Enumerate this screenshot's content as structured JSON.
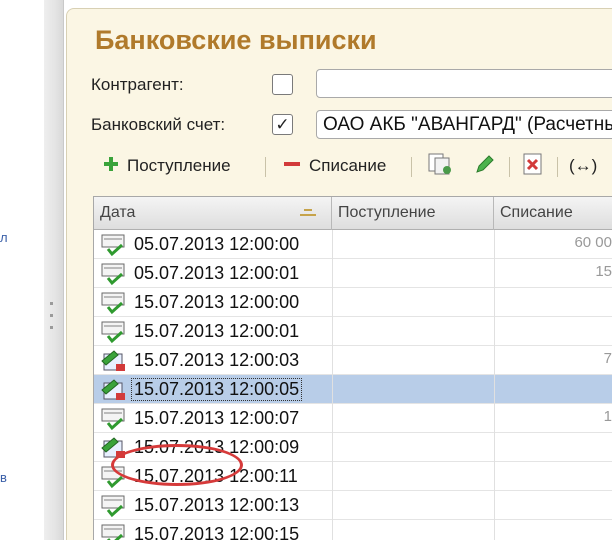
{
  "window": {
    "title": "Банковские выписки"
  },
  "left_panel": {
    "marks": [
      "л",
      "в"
    ]
  },
  "filters": {
    "counterparty": {
      "label": "Контрагент:",
      "checked": false,
      "value": ""
    },
    "bank_account": {
      "label": "Банковский счет:",
      "checked": true,
      "check_mark": "✓",
      "value": "ОАО АКБ \"АВАНГАРД\" (Расчетный)"
    }
  },
  "toolbar": {
    "receipt_label": "Поступление",
    "writeoff_label": "Списание",
    "period_label": "(↔)"
  },
  "table": {
    "columns": [
      "Дата",
      "Поступление",
      "Списание"
    ],
    "rows": [
      {
        "date": "05.07.2013 12:00:00",
        "incoming": "",
        "outgoing": "60 00",
        "icon": "check-doc-icon",
        "selected": false
      },
      {
        "date": "05.07.2013 12:00:01",
        "incoming": "",
        "outgoing": "15",
        "icon": "check-doc-icon",
        "selected": false
      },
      {
        "date": "15.07.2013 12:00:00",
        "incoming": "",
        "outgoing": "",
        "icon": "check-doc-icon",
        "selected": false
      },
      {
        "date": "15.07.2013 12:00:01",
        "incoming": "",
        "outgoing": "",
        "icon": "check-doc-icon",
        "selected": false
      },
      {
        "date": "15.07.2013 12:00:03",
        "incoming": "",
        "outgoing": "7",
        "icon": "pen-doc-icon",
        "selected": false
      },
      {
        "date": "15.07.2013 12:00:05",
        "incoming": "",
        "outgoing": "",
        "icon": "pen-doc-icon",
        "selected": true
      },
      {
        "date": "15.07.2013 12:00:07",
        "incoming": "",
        "outgoing": "1",
        "icon": "check-doc-icon",
        "selected": false
      },
      {
        "date": "15.07.2013 12:00:09",
        "incoming": "",
        "outgoing": "",
        "icon": "pen-doc-icon",
        "selected": false
      },
      {
        "date": "15.07.2013 12:00:11",
        "incoming": "",
        "outgoing": "",
        "icon": "check-doc-icon",
        "selected": false
      },
      {
        "date": "15.07.2013 12:00:13",
        "incoming": "",
        "outgoing": "",
        "icon": "check-doc-icon",
        "selected": false
      },
      {
        "date": "15.07.2013 12:00:15",
        "incoming": "",
        "outgoing": "",
        "icon": "check-doc-icon",
        "selected": false
      }
    ]
  },
  "colors": {
    "title": "#b07a2b",
    "background": "#fbf6e4",
    "selection": "#b8cde8",
    "annotation": "#d63a3a"
  }
}
